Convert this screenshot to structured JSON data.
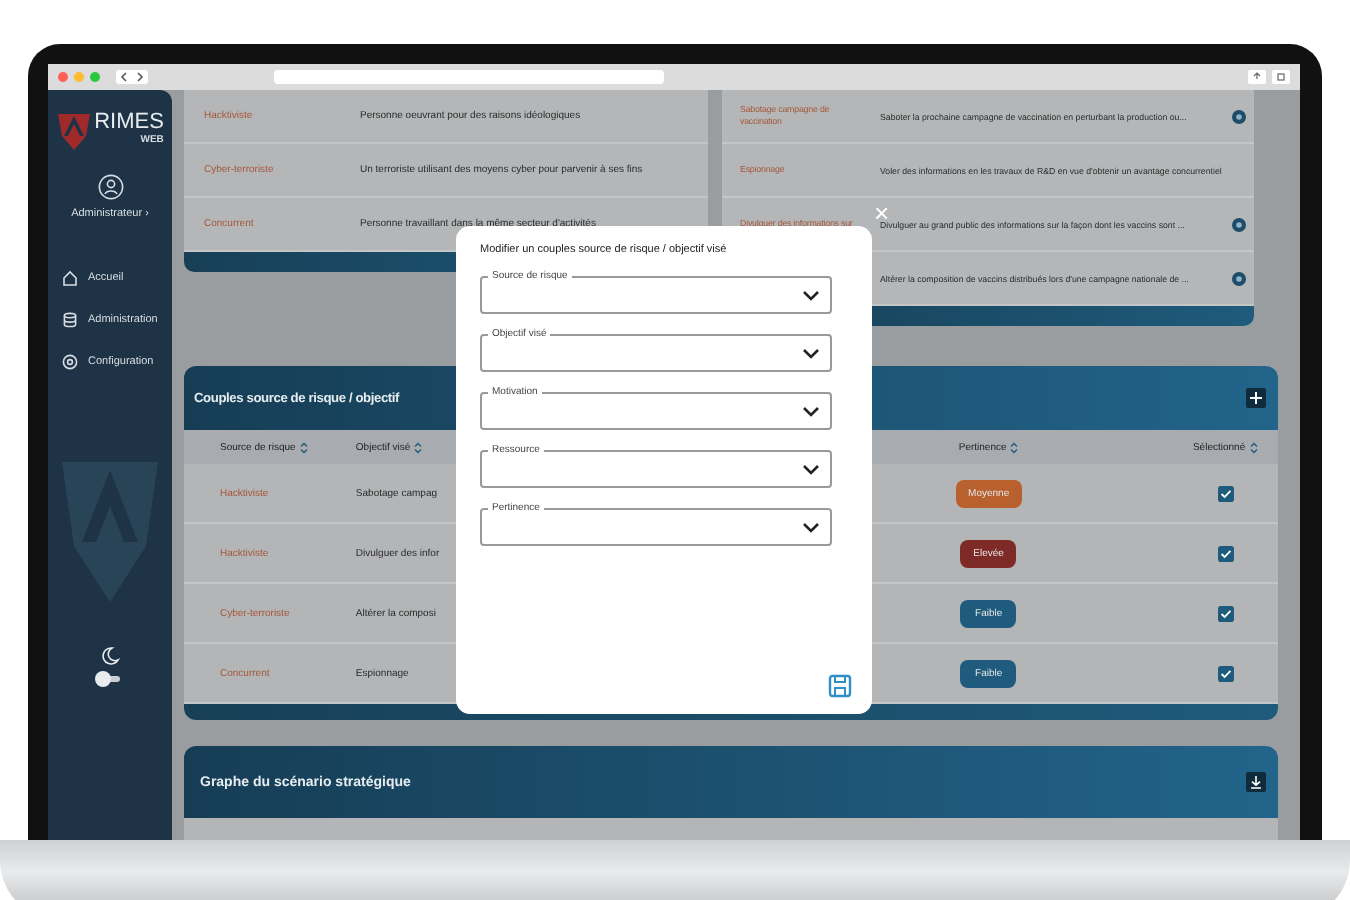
{
  "sidebar": {
    "dark_mode": false,
    "logo": {
      "name": "RIMES",
      "sub": "WEB"
    },
    "user": "Administrateur ›",
    "items": [
      {
        "label": "Accueil",
        "kind": "home"
      },
      {
        "label": "Administration",
        "kind": "database"
      },
      {
        "label": "Configuration",
        "kind": "settings"
      }
    ]
  },
  "sources": [
    {
      "name": "Hacktiviste",
      "description": "Personne oeuvrant pour des raisons idéologiques"
    },
    {
      "name": "Cyber-terroriste",
      "description": "Un terroriste utilisant des moyens cyber pour parvenir à ses fins"
    },
    {
      "name": "Concurrent",
      "description": "Personne travaillant dans la même secteur d'activités"
    }
  ],
  "objectives": [
    {
      "name": "Sabotage campagne de vaccination",
      "description": "Saboter la prochaine campagne de vaccination en perturbant la production ou...",
      "info": true
    },
    {
      "name": "Espionnage",
      "description": "Voler des informations en les travaux de R&D en vue d'obtenir un avantage concurrentiel",
      "info": false
    },
    {
      "name": "Divulguer des informations sur",
      "description": "Divulguer au grand public des informations sur la façon dont les vaccins sont ...",
      "info": true
    },
    {
      "description": "Altérer la composition de vaccins distribués lors d'une campagne nationale de ...",
      "info": true
    }
  ],
  "couples": {
    "title": "Couples source de risque / objectif",
    "columns": [
      "Source de risque",
      "Objectif visé",
      "Pertinence",
      "Sélectionné"
    ],
    "rows": [
      {
        "source": "Hacktiviste",
        "objective": "Sabotage campag",
        "pertinence": "Moyenne",
        "color": "#b8602e",
        "checked": true
      },
      {
        "source": "Hacktiviste",
        "objective": "Divulguer des infor",
        "pertinence": "Elevée",
        "color": "#7e2a27",
        "checked": true
      },
      {
        "source": "Cyber-terroriste",
        "objective": "Altérer la composi",
        "pertinence": "Faible",
        "color": "#1f5b7c",
        "checked": true
      },
      {
        "source": "Concurrent",
        "objective": "Espionnage",
        "pertinence": "Faible",
        "color": "#1f5b7c",
        "checked": true
      }
    ]
  },
  "graph": {
    "title": "Graphe du scénario stratégique"
  },
  "modal": {
    "title": "Modifier un couples source de risque / objectif visé",
    "close": "×",
    "fields": [
      {
        "label": "Source de risque"
      },
      {
        "label": "Objectif visé"
      },
      {
        "label": "Motivation"
      },
      {
        "label": "Ressource"
      },
      {
        "label": "Pertinence"
      }
    ]
  }
}
